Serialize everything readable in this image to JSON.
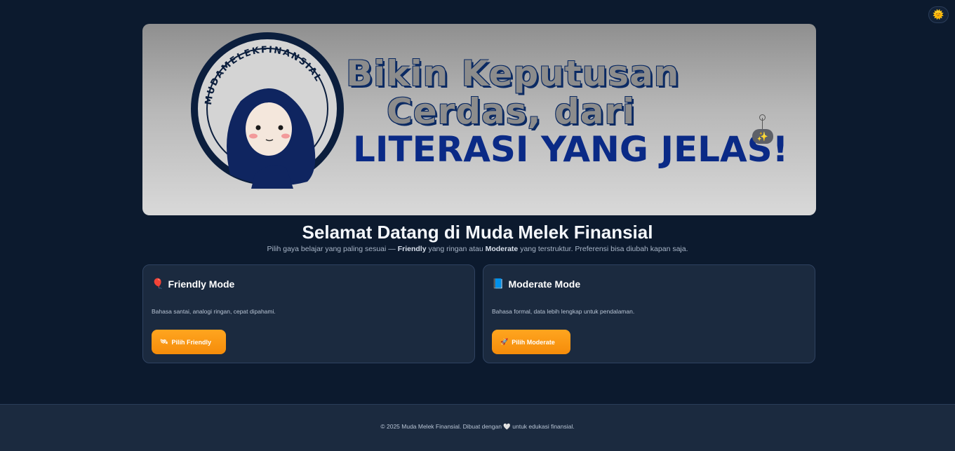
{
  "theme_toggle": {
    "icon": "sun-icon",
    "glyph": "🌞"
  },
  "hero": {
    "logo_text": "MUDAMELEKFINANSIAL",
    "headline_line1": "Bikin Keputusan",
    "headline_line2": "Cerdas, dari",
    "headline_line3": "LITERASI YANG JELAS!",
    "sparkle_glyph": "✨"
  },
  "welcome": {
    "title": "Selamat Datang di Muda Melek Finansial",
    "subtitle_pre": "Pilih gaya belajar yang paling sesuai — ",
    "subtitle_friendly": "Friendly",
    "subtitle_mid": " yang ringan atau ",
    "subtitle_moderate": "Moderate",
    "subtitle_post": " yang terstruktur. Preferensi bisa diubah kapan saja."
  },
  "cards": {
    "friendly": {
      "icon_glyph": "🎈",
      "title": "Friendly Mode",
      "description": "Bahasa santai, analogi ringan, cepat dipahami.",
      "button_glyph": "🛰",
      "button_label": "Pilih Friendly"
    },
    "moderate": {
      "icon_glyph": "📘",
      "title": "Moderate Mode",
      "description": "Bahasa formal, data lebih lengkap untuk pendalaman.",
      "button_glyph": "🚀",
      "button_label": "Pilih Moderate"
    }
  },
  "footer": {
    "text": "© 2025 Muda Melek Finansial. Dibuat dengan 🤍 untuk edukasi finansial."
  }
}
